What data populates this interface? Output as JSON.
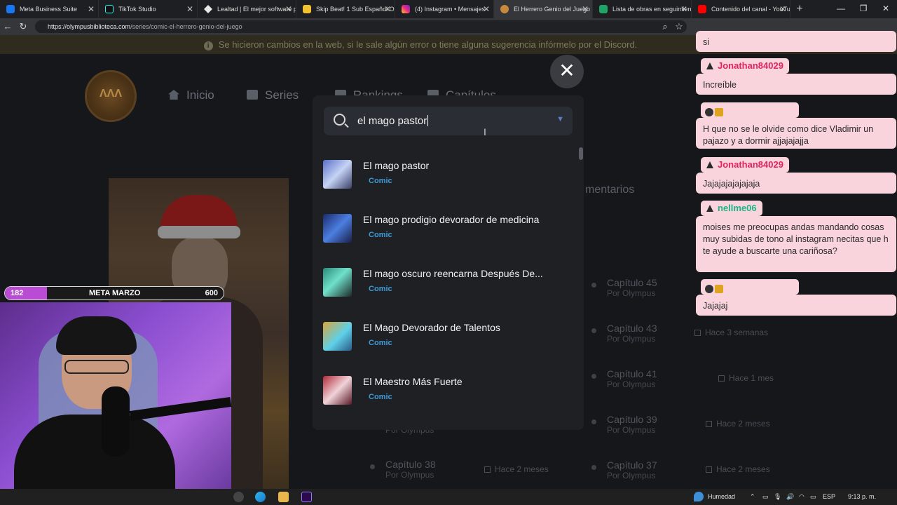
{
  "browser": {
    "tabs": [
      {
        "label": "Meta Business Suite",
        "color": "#1877f2",
        "active": false
      },
      {
        "label": "TikTok Studio",
        "color": "#111111",
        "active": false
      },
      {
        "label": "Lealtad | El mejor software p",
        "color": "#e8e8e8",
        "active": false
      },
      {
        "label": "Skip Beat! 1 Sub Español On",
        "color": "#f2c230",
        "active": false
      },
      {
        "label": "(4) Instagram • Mensajes",
        "color": "#d6249f",
        "active": false
      },
      {
        "label": "El Herrero Genio del Juego",
        "color": "#c78a3c",
        "active": true
      },
      {
        "label": "Lista de obras en seguimien",
        "color": "#1fa463",
        "active": false
      },
      {
        "label": "Contenido del canal - YouTu",
        "color": "#ff0000",
        "active": false
      }
    ],
    "new_tab": "+",
    "url_host": "https://olympusbiblioteca.com",
    "url_path": "/series/comic-el-herrero-genio-del-juego"
  },
  "site": {
    "notice": "Se hicieron cambios en la web, si le sale algún error o tiene alguna sugerencia infórmelo por el Discord.",
    "nav": {
      "home": "Inicio",
      "series": "Series",
      "rankings": "Rankings",
      "chapters": "Capítulos"
    },
    "comments_tab": "mentarios",
    "chapters": [
      {
        "title": "Capítulo 45",
        "by": "Por Olympus",
        "date": ""
      },
      {
        "title": "Capítulo 43",
        "by": "Por Olympus",
        "date": "Hace 3 semanas"
      },
      {
        "title": "Capítulo 41",
        "by": "Por Olympus",
        "date": "Hace 1 mes"
      },
      {
        "title": "Capítulo 39",
        "by": "Por Olympus",
        "date": "Hace 2 meses"
      },
      {
        "title": "Capítulo 37",
        "by": "Por Olympus",
        "date": "Hace 2 meses"
      }
    ],
    "left_chapters": [
      {
        "title": "",
        "by": "Por Olympus",
        "date": ""
      },
      {
        "title": "Capítulo 38",
        "by": "Por Olympus",
        "date": "Hace 2 meses"
      }
    ]
  },
  "search_modal": {
    "close_glyph": "✕",
    "query": "el mago pastor",
    "results": [
      {
        "title": "El mago pastor",
        "type": "Comic"
      },
      {
        "title": "El mago prodigio devorador de medicina",
        "type": "Comic"
      },
      {
        "title": "El mago oscuro reencarna Después De...",
        "type": "Comic"
      },
      {
        "title": "El Mago Devorador de Talentos",
        "type": "Comic"
      },
      {
        "title": "El Maestro Más Fuerte",
        "type": "Comic"
      }
    ]
  },
  "chat": {
    "messages": [
      {
        "user": "",
        "user_color": "",
        "text": "si"
      },
      {
        "user": "Jonathan84029",
        "user_color": "#e0245e",
        "text": "Increíble"
      },
      {
        "user": "",
        "user_color": "",
        "text": "H que no se le olvide como dice Vladimir un pajazo y a dormir ajjajajajja"
      },
      {
        "user": "Jonathan84029",
        "user_color": "#e0245e",
        "text": "Jajajajajajajaja"
      },
      {
        "user": "nellme06",
        "user_color": "#1bb585",
        "text": "moises me preocupas andas mandando cosas muy subidas de tono al instagram necitas que h te ayude a buscarte una cariñosa?"
      },
      {
        "user": "",
        "user_color": "",
        "text": "Jajajaj"
      }
    ]
  },
  "stream": {
    "goal_current": "182",
    "goal_label": "META MARZO",
    "goal_target": "600",
    "goal_fill_color": "#b94bd4"
  },
  "taskbar": {
    "weather": "Humedad",
    "lang": "ESP",
    "time": "9:13 p. m."
  }
}
